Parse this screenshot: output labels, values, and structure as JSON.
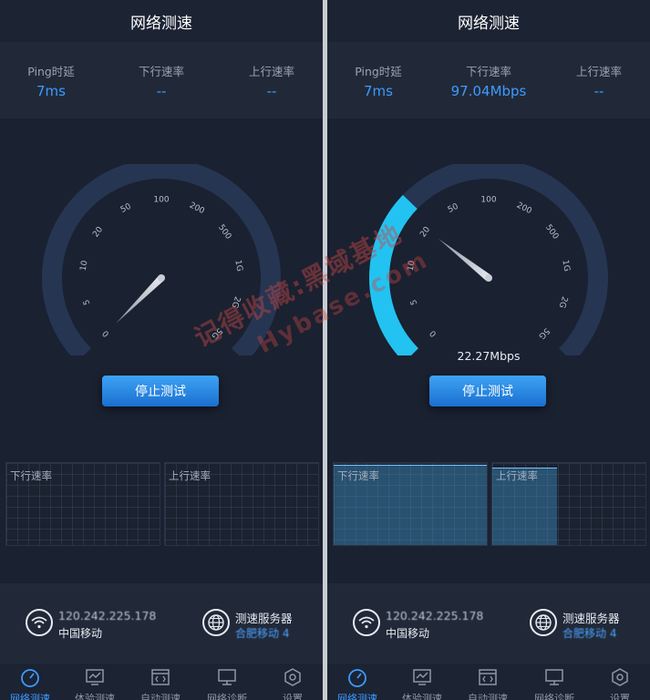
{
  "screens": [
    {
      "title": "网络测速",
      "stats": [
        {
          "label": "Ping时延",
          "value": "7ms"
        },
        {
          "label": "下行速率",
          "value": "--"
        },
        {
          "label": "上行速率",
          "value": "--"
        }
      ],
      "gauge": {
        "ticks": [
          "0",
          "5",
          "10",
          "20",
          "50",
          "100",
          "200",
          "500",
          "1G",
          "2G",
          "5G"
        ],
        "needle_value_mbps": 0,
        "progress_fraction": 0,
        "current_speed": ""
      },
      "stop_button": "停止测试",
      "panels": {
        "download_label": "下行速率",
        "upload_label": "上行速率"
      },
      "info": {
        "ip": "120.242.225.178",
        "carrier": "中国移动",
        "server_title": "测速服务器",
        "server_name": "合肥移动 4"
      },
      "nav": [
        "网络测速",
        "体验测速",
        "自动测速",
        "网络诊断",
        "设置"
      ],
      "active_tab": 0
    },
    {
      "title": "网络测速",
      "stats": [
        {
          "label": "Ping时延",
          "value": "7ms"
        },
        {
          "label": "下行速率",
          "value": "97.04Mbps"
        },
        {
          "label": "上行速率",
          "value": "--"
        }
      ],
      "gauge": {
        "ticks": [
          "0",
          "5",
          "10",
          "20",
          "50",
          "100",
          "200",
          "500",
          "1G",
          "2G",
          "5G"
        ],
        "needle_value_mbps": 22.27,
        "progress_fraction": 0.33,
        "current_speed": "22.27Mbps"
      },
      "stop_button": "停止测试",
      "panels": {
        "download_label": "下行速率",
        "upload_label": "上行速率",
        "download_fill": 0.97,
        "upload_fill": 0.93
      },
      "info": {
        "ip": "120.242.225.178",
        "carrier": "中国移动",
        "server_title": "测速服务器",
        "server_name": "合肥移动 4"
      },
      "nav": [
        "网络测速",
        "体验测速",
        "自动测速",
        "网络诊断",
        "设置"
      ],
      "active_tab": 0
    }
  ],
  "watermark": {
    "line1": "记得收藏:黑域基地",
    "line2": "Hybase.com"
  },
  "colors": {
    "accent": "#3d9bff",
    "gauge_track": "#263552",
    "gauge_active": "#22c3f0",
    "button": "#2a86e0",
    "background": "#1a2130"
  }
}
